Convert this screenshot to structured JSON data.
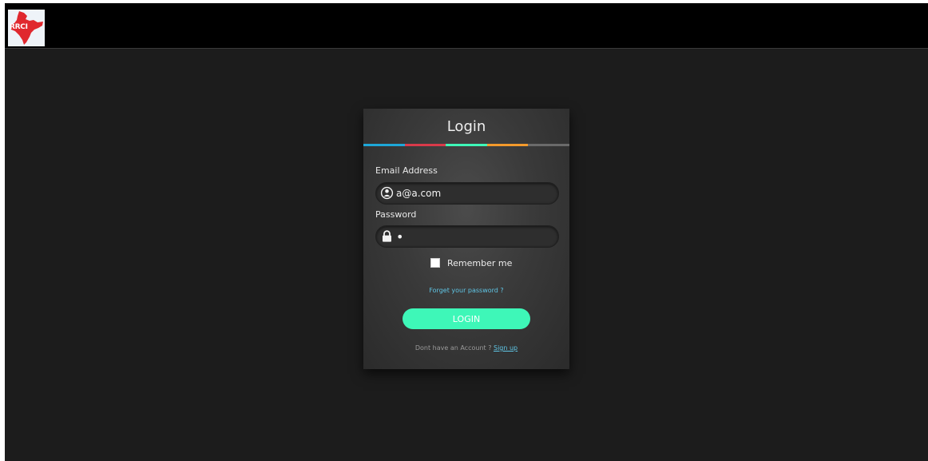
{
  "header": {
    "logo_text": "RRCI"
  },
  "login_form": {
    "title": "Login",
    "color_bar": [
      "#1ea7d8",
      "#d93a4a",
      "#3ef7b8",
      "#f39a2c",
      "#6a6a6a"
    ],
    "email": {
      "label": "Email Address",
      "value": "a@a.com",
      "icon": "user-icon"
    },
    "password": {
      "label": "Password",
      "value": "•",
      "icon": "lock-icon"
    },
    "remember_me": {
      "label": "Remember me",
      "checked": false
    },
    "forgot_password": "Forget your password ?",
    "login_button": "LOGIN",
    "signup_prompt": "Dont have an Account ?",
    "signup_link": "Sign up",
    "accent_color": "#3ef7b8",
    "link_color": "#5fc6e6"
  }
}
